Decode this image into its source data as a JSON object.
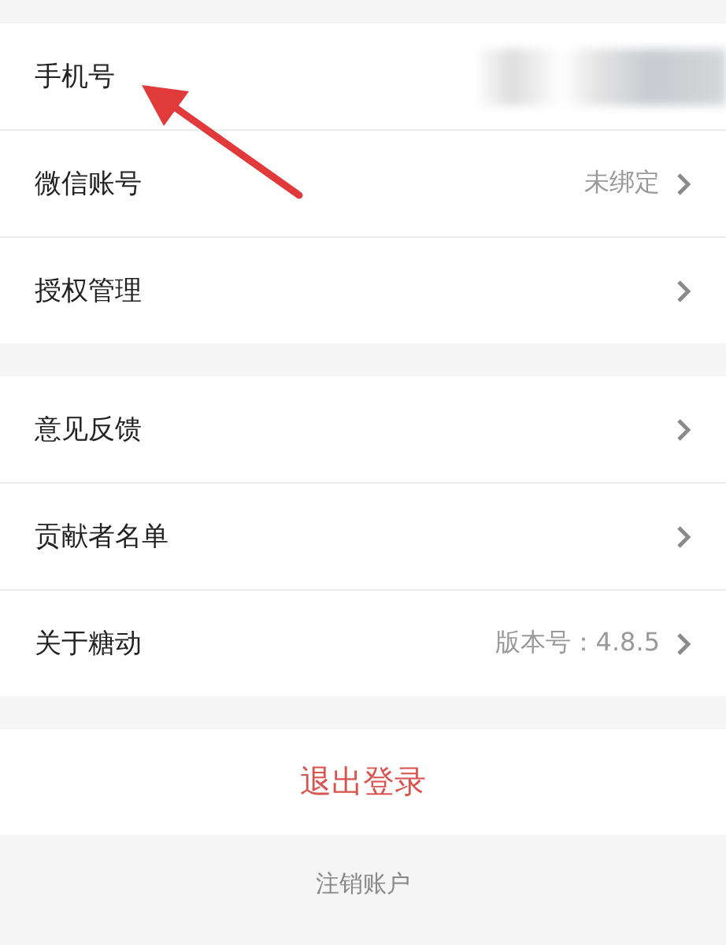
{
  "groups": [
    {
      "rows": [
        {
          "label": "手机号",
          "value_redacted": true,
          "chevron": false
        },
        {
          "label": "微信账号",
          "value": "未绑定",
          "chevron": true
        },
        {
          "label": "授权管理",
          "chevron": true
        }
      ]
    },
    {
      "rows": [
        {
          "label": "意见反馈",
          "chevron": true
        },
        {
          "label": "贡献者名单",
          "chevron": true
        },
        {
          "label": "关于糖动",
          "value": "版本号：4.8.5",
          "chevron": true
        }
      ]
    }
  ],
  "logout_button": "退出登录",
  "delete_account_link": "注销账户",
  "annotation_arrow": true
}
